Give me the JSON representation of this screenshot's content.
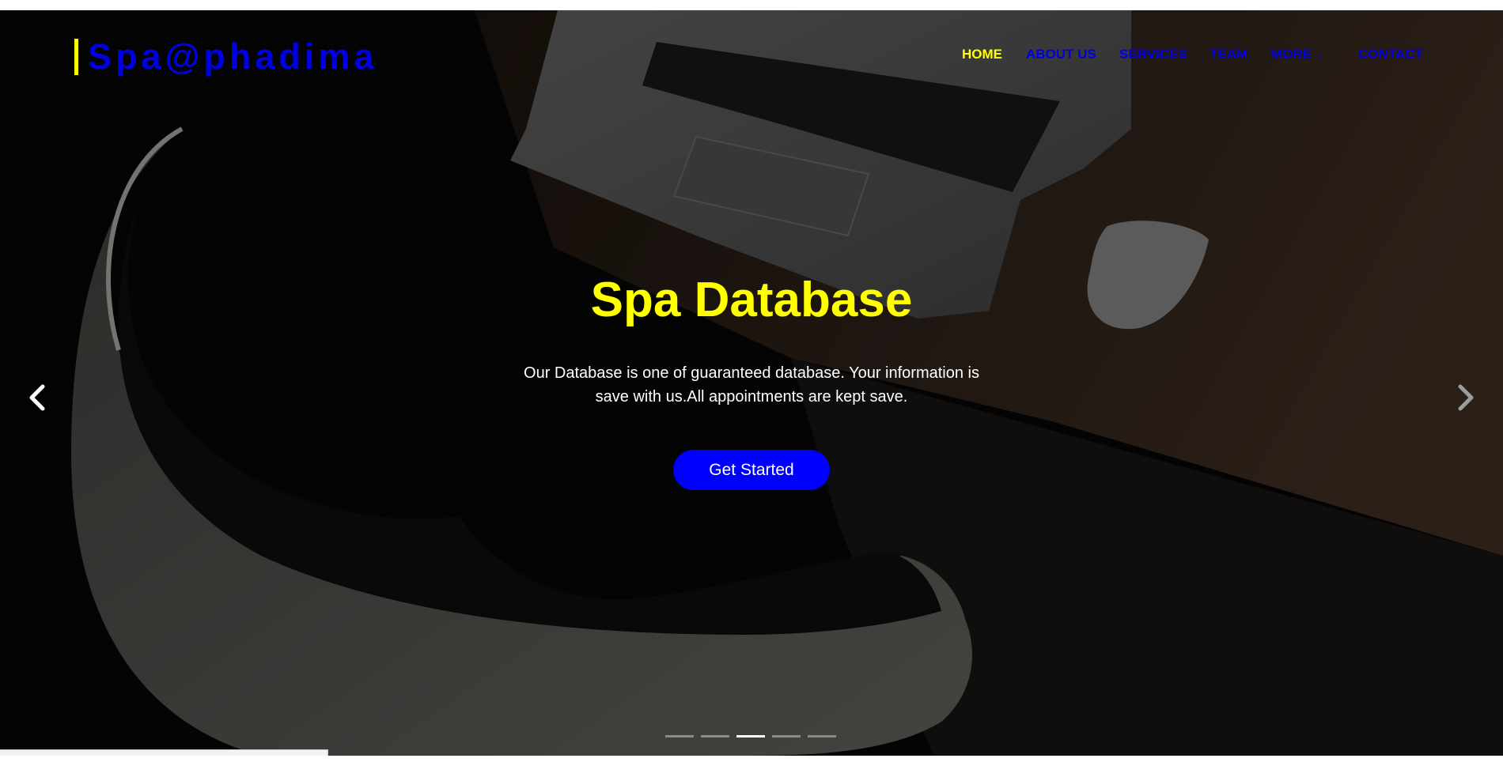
{
  "brand": {
    "name": "Spa@phadima"
  },
  "nav": {
    "items": [
      "HOME",
      "ABOUT US",
      "SERVICES",
      "TEAM",
      "MORE",
      "CONTACT"
    ],
    "active": "HOME"
  },
  "hero": {
    "title": "Spa Database",
    "text": "Our Database is one of guaranteed database. Your information is save with us.All appointments are kept save.",
    "button": "Get Started"
  },
  "carousel": {
    "slide_count": 5,
    "active_index": 2
  },
  "icons": {
    "prev": "chevron-left-icon",
    "next": "chevron-right-icon",
    "dropdown": "chevron-down-icon"
  },
  "status_bar": {
    "url": "file:///C:/Users/ilife/Desktop/ISAT 2020/index.html#introCarousel"
  },
  "colors": {
    "accent_yellow": "#ffff00",
    "nav_blue": "#0000e0",
    "button_blue": "#0000ff",
    "text_white": "#ffffff"
  }
}
